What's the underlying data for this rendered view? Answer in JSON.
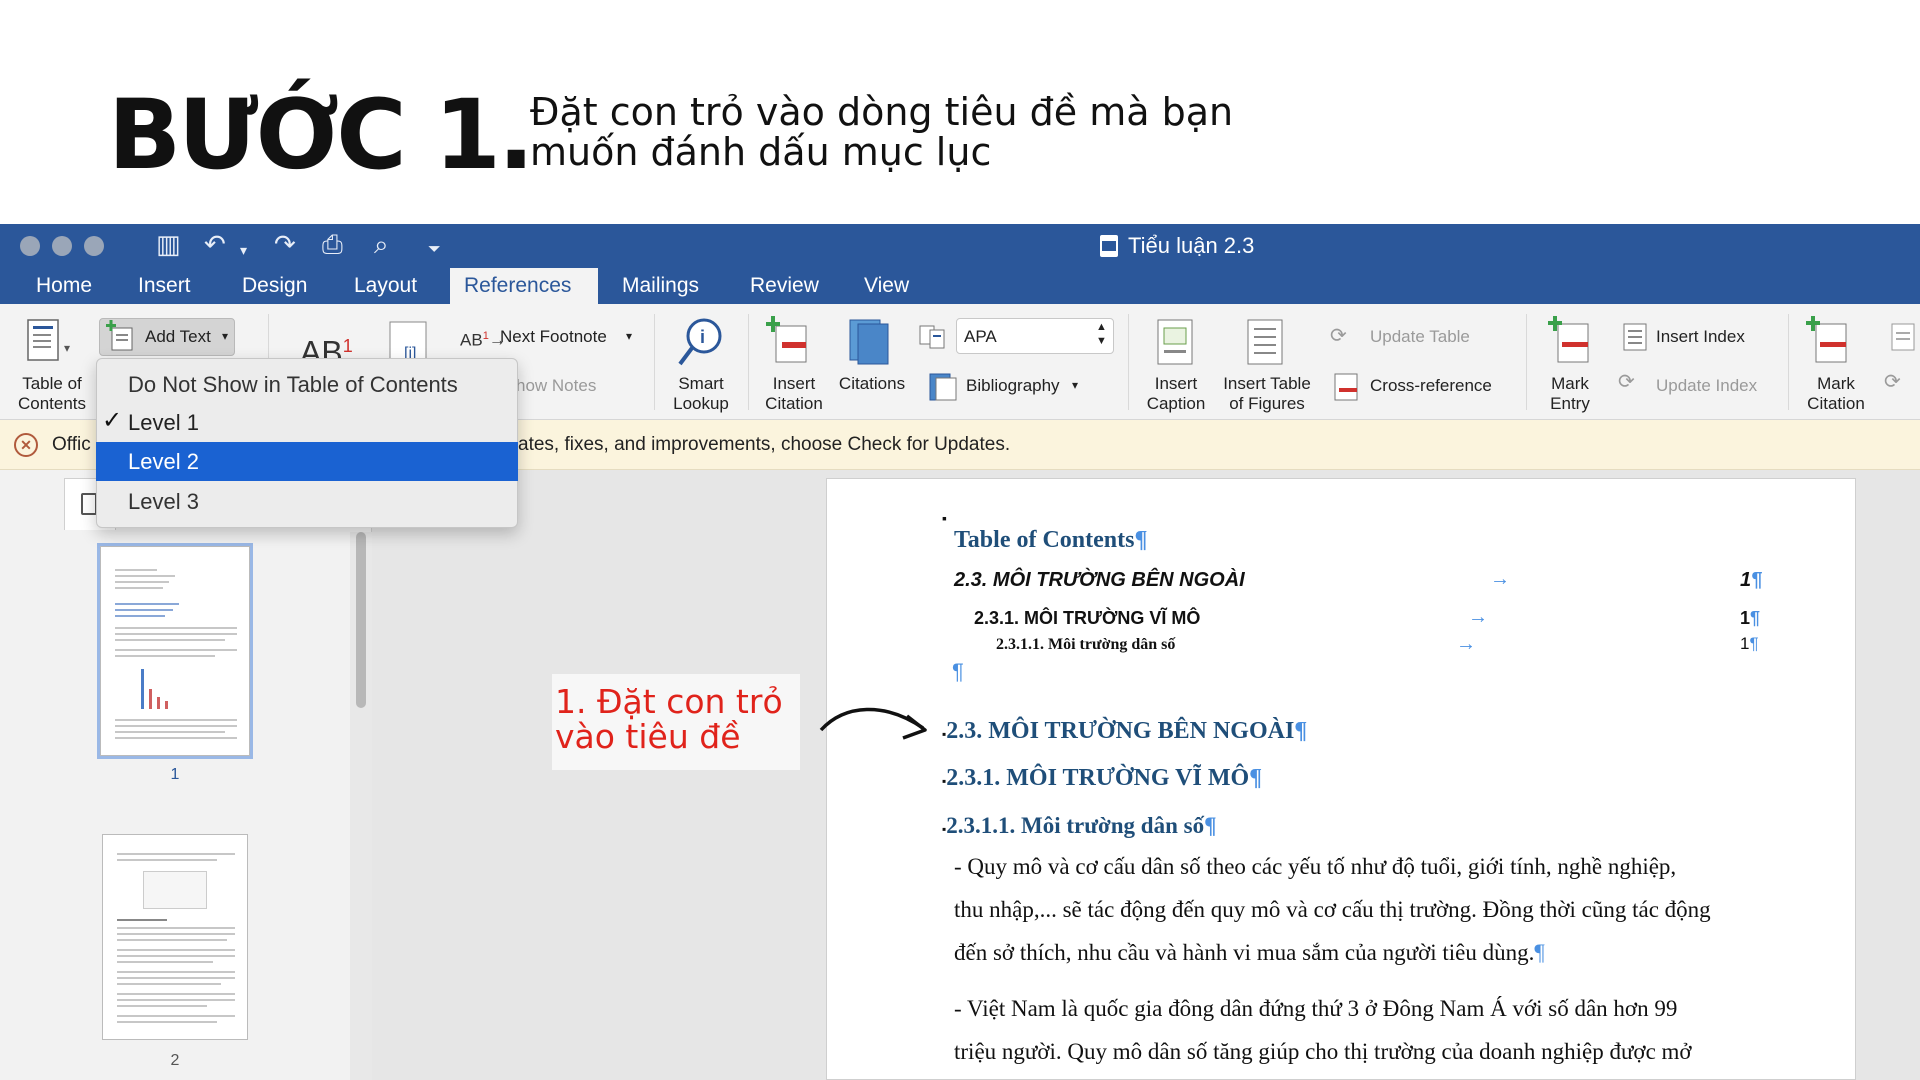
{
  "header": {
    "step_title": "BƯỚC 1.",
    "step_desc_line1": "Đặt con trỏ vào dòng tiêu đề mà bạn",
    "step_desc_line2": "muốn đánh dấu mục lục"
  },
  "window": {
    "title": "Tiểu luận 2.3",
    "accent": "#2b579a"
  },
  "tabs": [
    {
      "label": "Home"
    },
    {
      "label": "Insert"
    },
    {
      "label": "Design"
    },
    {
      "label": "Layout"
    },
    {
      "label": "References"
    },
    {
      "label": "Mailings"
    },
    {
      "label": "Review"
    },
    {
      "label": "View"
    }
  ],
  "ribbon": {
    "toc_line1": "Table of",
    "toc_line2": "Contents",
    "add_text": "Add Text",
    "ab_label": "AB",
    "ab_sup": "1",
    "next_footnote": "Next Footnote",
    "show_notes": "how Notes",
    "smart_line1": "Smart",
    "smart_line2": "Lookup",
    "insert_citation_line1": "Insert",
    "insert_citation_line2": "Citation",
    "citations": "Citations",
    "style_value": "APA",
    "bibliography": "Bibliography",
    "insert_caption_line1": "Insert",
    "insert_caption_line2": "Caption",
    "insert_tof_line1": "Insert Table",
    "insert_tof_line2": "of Figures",
    "update_table": "Update Table",
    "cross_reference": "Cross-reference",
    "mark_entry_line1": "Mark",
    "mark_entry_line2": "Entry",
    "insert_index": "Insert Index",
    "update_index": "Update Index",
    "mark_citation_line1": "Mark",
    "mark_citation_line2": "Citation"
  },
  "notice": {
    "left": "Offic",
    "right": "ates, fixes, and improvements, choose Check for Updates."
  },
  "dropdown": {
    "items": [
      "Do Not Show in Table of Contents",
      "Level 1",
      "Level 2",
      "Level 3"
    ],
    "checked": "Level 1",
    "highlighted": "Level 2"
  },
  "thumbnails": {
    "page1": "1",
    "page2": "2"
  },
  "document": {
    "toc_title": "Table of Contents",
    "toc_entries": [
      {
        "text": "2.3. MÔI TRƯỜNG BÊN NGOÀI",
        "page": "1"
      },
      {
        "text": "2.3.1. MÔI TRƯỜNG VĨ MÔ",
        "page": "1"
      },
      {
        "text": "2.3.1.1. Môi trường dân số",
        "page": "1"
      }
    ],
    "heading1": "2.3. MÔI TRƯỜNG BÊN NGOÀI",
    "heading2": "2.3.1. MÔI TRƯỜNG VĨ MÔ",
    "heading3": "2.3.1.1. Môi trường dân số",
    "para1_line1": "- Quy mô và cơ cấu dân số theo các yếu tố như độ tuổi, giới tính, nghề nghiệp,",
    "para1_line2": "thu nhập,... sẽ tác động đến quy mô và cơ cấu thị trường. Đồng thời cũng tác động",
    "para1_line3": "đến sở thích, nhu cầu và hành vi mua sắm của người tiêu dùng.",
    "para2_line1": "- Việt Nam là quốc gia đông dân đứng thứ 3 ở Đông Nam Á với số dân hơn 99",
    "para2_line2": "triệu người. Quy mô dân số tăng giúp cho thị trường của doanh nghiệp được mở",
    "pilcrow": "¶"
  },
  "callout": {
    "line1": "1. Đặt con trỏ",
    "line2": "vào tiêu đề",
    "color": "#e0231b"
  }
}
